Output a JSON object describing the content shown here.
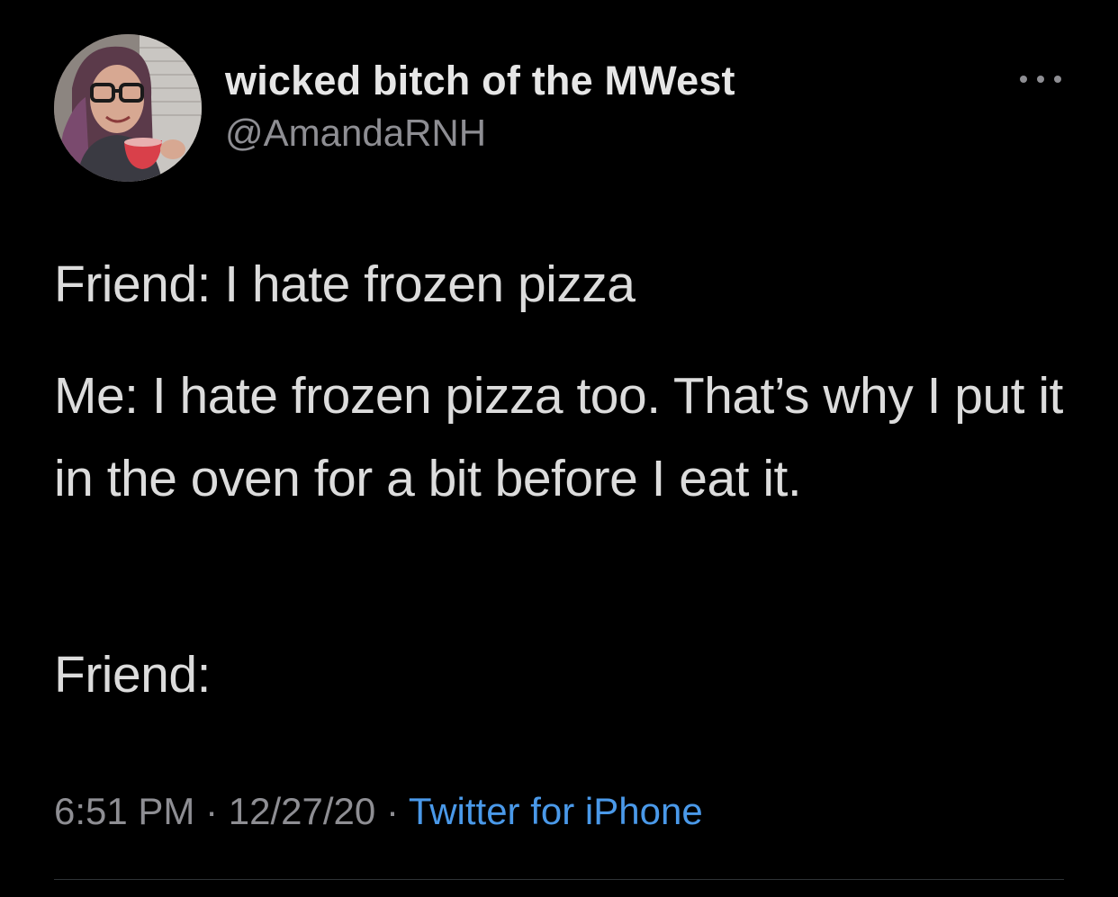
{
  "author": {
    "display_name": "wicked bitch of the MWest",
    "handle": "@AmandaRNH",
    "avatar_icon": "profile-photo"
  },
  "menu": {
    "icon": "more-horizontal-icon"
  },
  "tweet": {
    "paragraphs": [
      "Friend: I hate frozen pizza",
      "Me: I hate frozen pizza too. That’s why I put it in the oven for a bit before I eat it.",
      "Friend:"
    ]
  },
  "meta": {
    "time": "6:51 PM",
    "separator": "·",
    "date": "12/27/20",
    "source": "Twitter for iPhone"
  },
  "colors": {
    "background": "#000000",
    "text": "#dcdcdc",
    "secondary": "#8e8e93",
    "link": "#4a99e9"
  }
}
